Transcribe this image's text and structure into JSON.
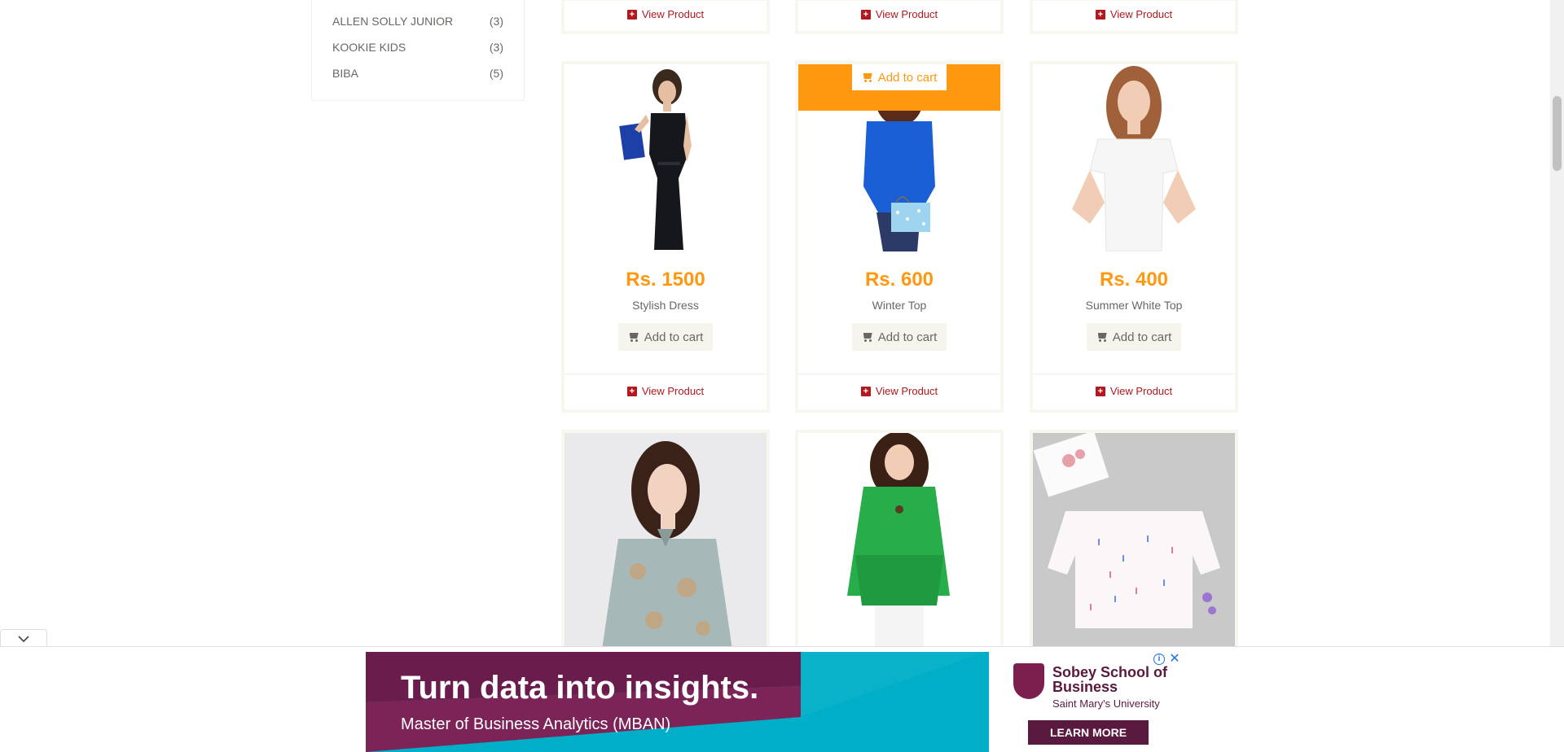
{
  "brands": [
    {
      "name": "ALLEN SOLLY JUNIOR",
      "count": "(3)"
    },
    {
      "name": "KOOKIE KIDS",
      "count": "(3)"
    },
    {
      "name": "BIBA",
      "count": "(5)"
    }
  ],
  "view_product_label": "View Product",
  "add_to_cart_label": "Add to cart",
  "products": [
    {
      "price": "Rs. 1500",
      "name": "Stylish Dress"
    },
    {
      "price": "Rs. 600",
      "name": "Winter Top"
    },
    {
      "price": "Rs. 400",
      "name": "Summer White Top"
    }
  ],
  "ad": {
    "headline": "Turn data into insights.",
    "subline": "Master of Business Analytics (MBAN)",
    "brand": "Sobey School of Business",
    "university": "Saint Mary's University",
    "cta": "LEARN MORE",
    "info_glyph": "i",
    "close_glyph": "✕"
  },
  "colors": {
    "accent": "#fe980f",
    "link": "#b3181e",
    "text": "#696763",
    "ad_primary": "#00aec7",
    "ad_brand": "#5a1a3f"
  },
  "icons": {
    "view_product": "plus-square-icon",
    "add_to_cart": "shopping-cart-icon",
    "ad_toggle": "chevron-down-icon"
  }
}
